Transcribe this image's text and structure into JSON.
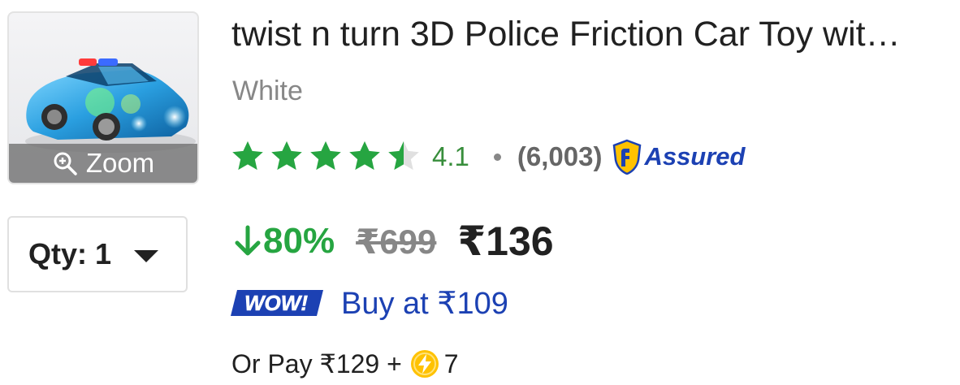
{
  "product": {
    "title": "twist n turn 3D Police Friction Car Toy wit…",
    "variant": "White",
    "zoom_label": "Zoom"
  },
  "quantity": {
    "label": "Qty: 1"
  },
  "rating": {
    "value": "4.1",
    "stars": 4.1,
    "max_stars": 5,
    "count": "(6,003)",
    "assured_label": "Assured"
  },
  "pricing": {
    "discount": "80%",
    "mrp": "₹699",
    "price": "₹136"
  },
  "wow": {
    "badge": "WOW!",
    "text": "Buy at ₹109"
  },
  "supercoin": {
    "prefix": "Or Pay ₹129 +",
    "coins": "7"
  },
  "colors": {
    "star": "#26a541",
    "discount": "#26a541",
    "link_blue": "#1c41b3",
    "coin": "#ffc200"
  },
  "icons": {
    "zoom": "magnifier-plus-icon",
    "qty_dropdown": "caret-down-icon",
    "assured": "assured-shield-icon",
    "discount": "arrow-down-icon",
    "coin": "lightning-coin-icon"
  }
}
